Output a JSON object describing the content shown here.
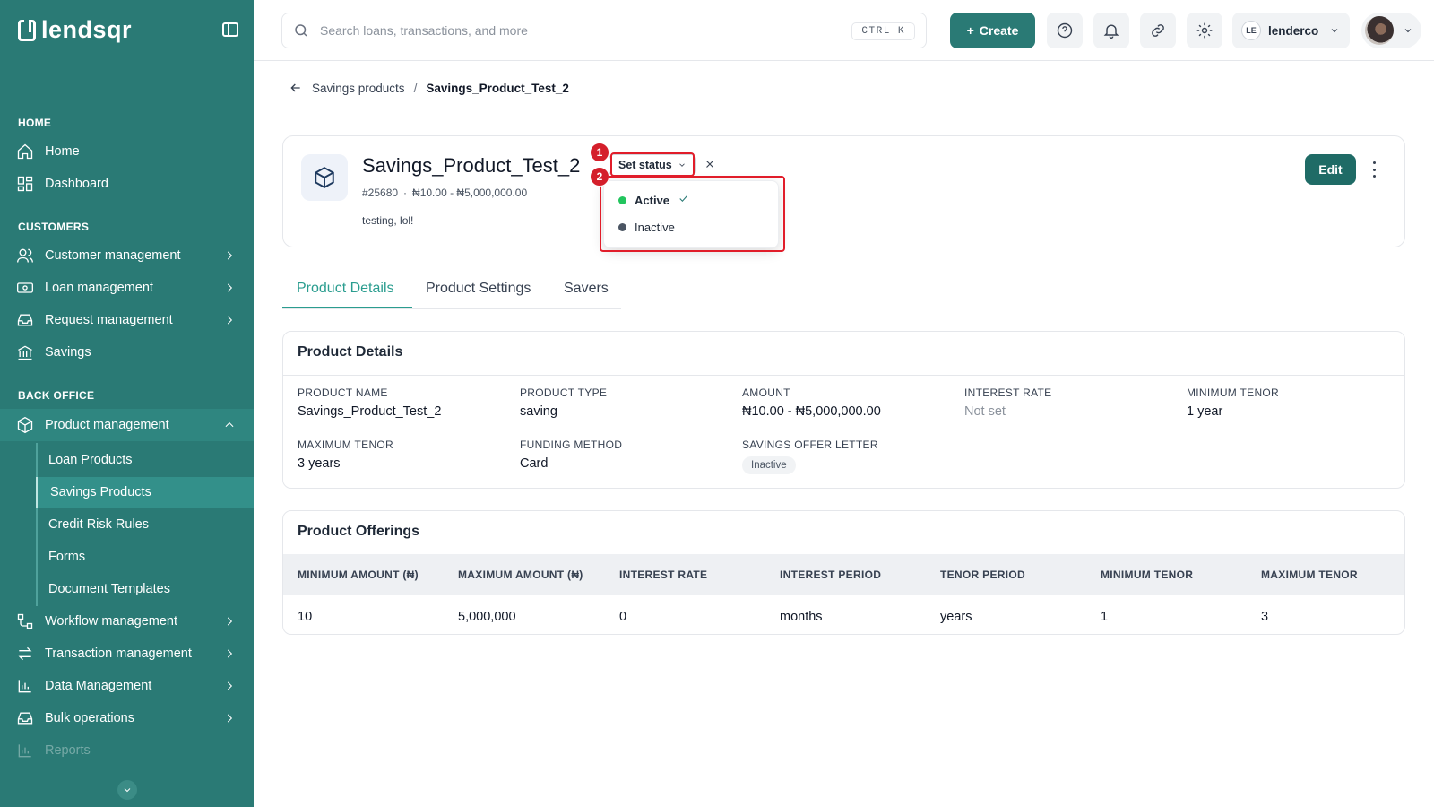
{
  "brand": {
    "name": "lendsqr"
  },
  "sidebar": {
    "sections": {
      "home": "HOME",
      "customers": "CUSTOMERS",
      "back_office": "BACK OFFICE"
    },
    "items": {
      "home": "Home",
      "dashboard": "Dashboard",
      "customer_management": "Customer management",
      "loan_management": "Loan management",
      "request_management": "Request management",
      "savings": "Savings",
      "product_management": "Product management",
      "workflow_management": "Workflow management",
      "transaction_management": "Transaction management",
      "data_management": "Data Management",
      "bulk_operations": "Bulk operations",
      "reports": "Reports"
    },
    "sub_items": [
      "Loan Products",
      "Savings Products",
      "Credit Risk Rules",
      "Forms",
      "Document Templates"
    ],
    "selected_sub_item": "Savings Products"
  },
  "topbar": {
    "search_placeholder": "Search loans, transactions, and more",
    "shortcut": "CTRL K",
    "create_label": "Create",
    "org_initials": "LE",
    "org_name": "lenderco"
  },
  "breadcrumb": {
    "parent": "Savings products",
    "separator": "/",
    "current": "Savings_Product_Test_2"
  },
  "product": {
    "title": "Savings_Product_Test_2",
    "id": "#25680",
    "meta_sep": "·",
    "range": "₦10.00 - ₦5,000,000.00",
    "description": "testing, lol!",
    "status_button": "Set status",
    "edit_label": "Edit"
  },
  "status_dropdown": {
    "options": [
      {
        "label": "Active",
        "color": "#22c55e",
        "selected": true
      },
      {
        "label": "Inactive",
        "color": "#4b5563",
        "selected": false
      }
    ]
  },
  "annotations": {
    "badge1": "1",
    "badge2": "2",
    "color": "#e11d2a"
  },
  "tabs": [
    "Product Details",
    "Product Settings",
    "Savers"
  ],
  "details": {
    "title": "Product Details",
    "fields": [
      {
        "label": "PRODUCT NAME",
        "value": "Savings_Product_Test_2"
      },
      {
        "label": "PRODUCT TYPE",
        "value": "saving"
      },
      {
        "label": "AMOUNT",
        "value": "₦10.00 - ₦5,000,000.00"
      },
      {
        "label": "INTEREST RATE",
        "value": "Not set"
      },
      {
        "label": "MINIMUM TENOR",
        "value": "1 year"
      },
      {
        "label": "MAXIMUM TENOR",
        "value": "3 years"
      },
      {
        "label": "FUNDING METHOD",
        "value": "Card"
      },
      {
        "label": "SAVINGS OFFER LETTER",
        "value": "Inactive"
      }
    ]
  },
  "offerings": {
    "title": "Product Offerings",
    "columns": [
      "MINIMUM AMOUNT (₦)",
      "MAXIMUM AMOUNT (₦)",
      "INTEREST RATE",
      "INTEREST PERIOD",
      "TENOR PERIOD",
      "MINIMUM TENOR",
      "MAXIMUM TENOR"
    ],
    "rows": [
      [
        "10",
        "5,000,000",
        "0",
        "months",
        "years",
        "1",
        "3"
      ]
    ]
  },
  "colors": {
    "sidebar": "#2a7a75",
    "accent": "#2a9d8f",
    "primary_button": "#1f6b66"
  }
}
